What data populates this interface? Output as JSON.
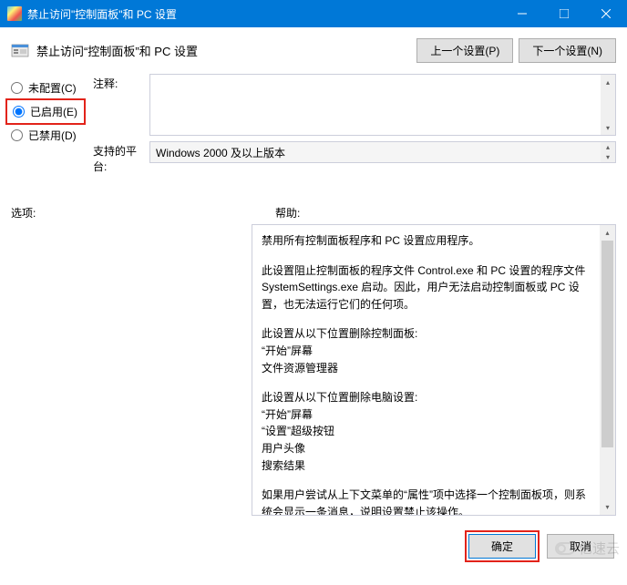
{
  "titlebar": {
    "title": "禁止访问\"控制面板\"和 PC 设置"
  },
  "header": {
    "title": "禁止访问“控制面板”和 PC 设置"
  },
  "nav": {
    "prev": "上一个设置(P)",
    "next": "下一个设置(N)"
  },
  "radios": {
    "not_configured": "未配置(C)",
    "enabled": "已启用(E)",
    "disabled": "已禁用(D)"
  },
  "fields": {
    "comment_label": "注释:",
    "platform_label": "支持的平台:",
    "platform_value": "Windows 2000 及以上版本"
  },
  "sections": {
    "options_label": "选项:",
    "help_label": "帮助:"
  },
  "help": {
    "p1": "禁用所有控制面板程序和 PC 设置应用程序。",
    "p2": "此设置阻止控制面板的程序文件 Control.exe 和 PC 设置的程序文件 SystemSettings.exe 启动。因此，用户无法启动控制面板或 PC 设置，也无法运行它们的任何项。",
    "p3a": "此设置从以下位置删除控制面板:",
    "p3b": "“开始”屏幕",
    "p3c": "文件资源管理器",
    "p4a": "此设置从以下位置删除电脑设置:",
    "p4b": "“开始”屏幕",
    "p4c": "“设置”超级按钮",
    "p4d": "用户头像",
    "p4e": "搜索结果",
    "p5": "如果用户尝试从上下文菜单的“属性”项中选择一个控制面板项，则系统会显示一条消息，说明设置禁止该操作。"
  },
  "footer": {
    "ok": "确定",
    "cancel": "取消"
  },
  "watermark": "亿速云"
}
